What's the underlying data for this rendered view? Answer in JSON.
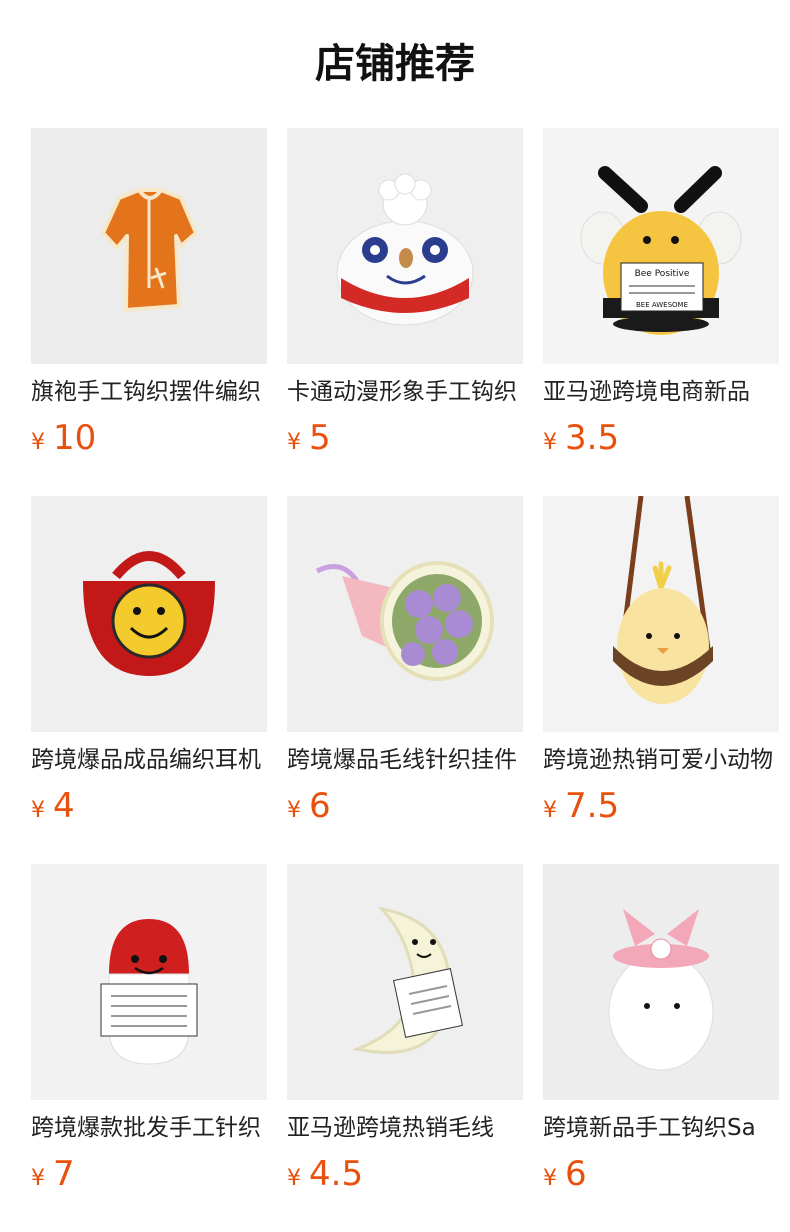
{
  "page": {
    "title": "店铺推荐"
  },
  "currency_symbol": "¥",
  "accent_color": "#e8500d",
  "products": [
    {
      "name": "旗袍手工钩织摆件编织",
      "price": "10",
      "image": "orange-qipao-image"
    },
    {
      "name": "卡通动漫形象手工钩织",
      "price": "5",
      "image": "clown-doll-image"
    },
    {
      "name": "亚马逊跨境电商新品",
      "price": "3.5",
      "image": "bee-positive-image"
    },
    {
      "name": "跨境爆品成品编织耳机",
      "price": "4",
      "image": "smiley-bag-image"
    },
    {
      "name": "跨境爆品毛线针织挂件",
      "price": "6",
      "image": "flower-bouquet-image"
    },
    {
      "name": "跨境逊热销可爱小动物",
      "price": "7.5",
      "image": "chick-swing-image"
    },
    {
      "name": "跨境爆款批发手工针织",
      "price": "7",
      "image": "chill-pill-image"
    },
    {
      "name": "亚马逊跨境热销毛线",
      "price": "4.5",
      "image": "moon-doll-image"
    },
    {
      "name": "跨境新品手工钩织Sa",
      "price": "6",
      "image": "bunny-egg-image"
    }
  ]
}
